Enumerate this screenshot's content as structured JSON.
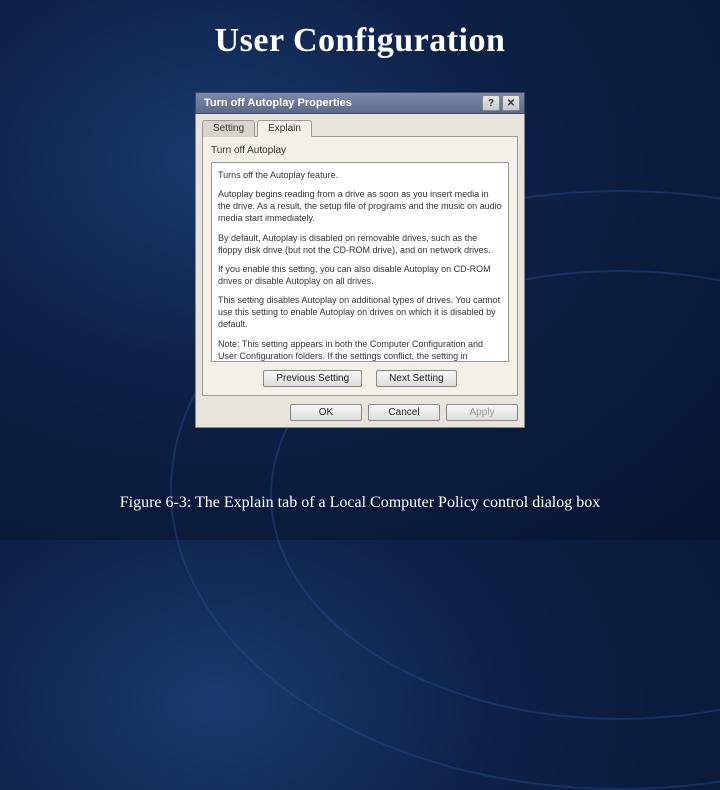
{
  "slide": {
    "title": "User Configuration",
    "caption": "Figure 6-3: The Explain tab of a Local Computer Policy control dialog box"
  },
  "dialog": {
    "title": "Turn off Autoplay Properties",
    "tabs": {
      "setting": "Setting",
      "explain": "Explain"
    },
    "policy_name": "Turn off Autoplay",
    "explain": {
      "p1": "Turns off the Autoplay feature.",
      "p2": "Autoplay begins reading from a drive as soon as you insert media in the drive. As a result, the setup file of programs and the music on audio media start immediately.",
      "p3": "By default, Autoplay is disabled on removable drives, such as the floppy disk drive (but not the CD-ROM drive), and on network drives.",
      "p4": "If you enable this setting, you can also disable Autoplay on CD-ROM drives or disable Autoplay on all drives.",
      "p5": "This setting disables Autoplay on additional types of drives. You cannot use this setting to enable Autoplay on drives on which it is disabled by default.",
      "p6": "Note: This setting appears in both the Computer Configuration and User Configuration folders. If the settings conflict, the setting in Computer Configuration takes precedence over the setting in User Configuration."
    },
    "nav": {
      "prev": "Previous Setting",
      "next": "Next Setting"
    },
    "buttons": {
      "ok": "OK",
      "cancel": "Cancel",
      "apply": "Apply"
    }
  }
}
